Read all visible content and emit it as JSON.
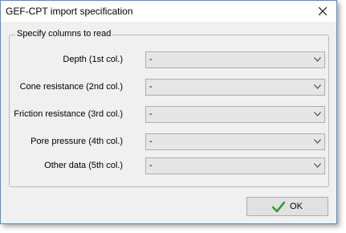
{
  "window": {
    "title": "GEF-CPT import specification",
    "close_icon": "close-icon"
  },
  "group": {
    "legend": "Specify columns to read"
  },
  "rows": [
    {
      "label": "Depth (1st col.)",
      "value": "-"
    },
    {
      "label": "Cone resistance (2nd col.)",
      "value": "-"
    },
    {
      "label": "Friction resistance (3rd col.)",
      "value": "-"
    },
    {
      "label": "Pore pressure (4th col.)",
      "value": "-"
    },
    {
      "label": "Other data (5th col.)",
      "value": "-"
    }
  ],
  "ok_button": {
    "label": "OK",
    "icon": "check-icon",
    "icon_color": "#2e9e2e"
  }
}
